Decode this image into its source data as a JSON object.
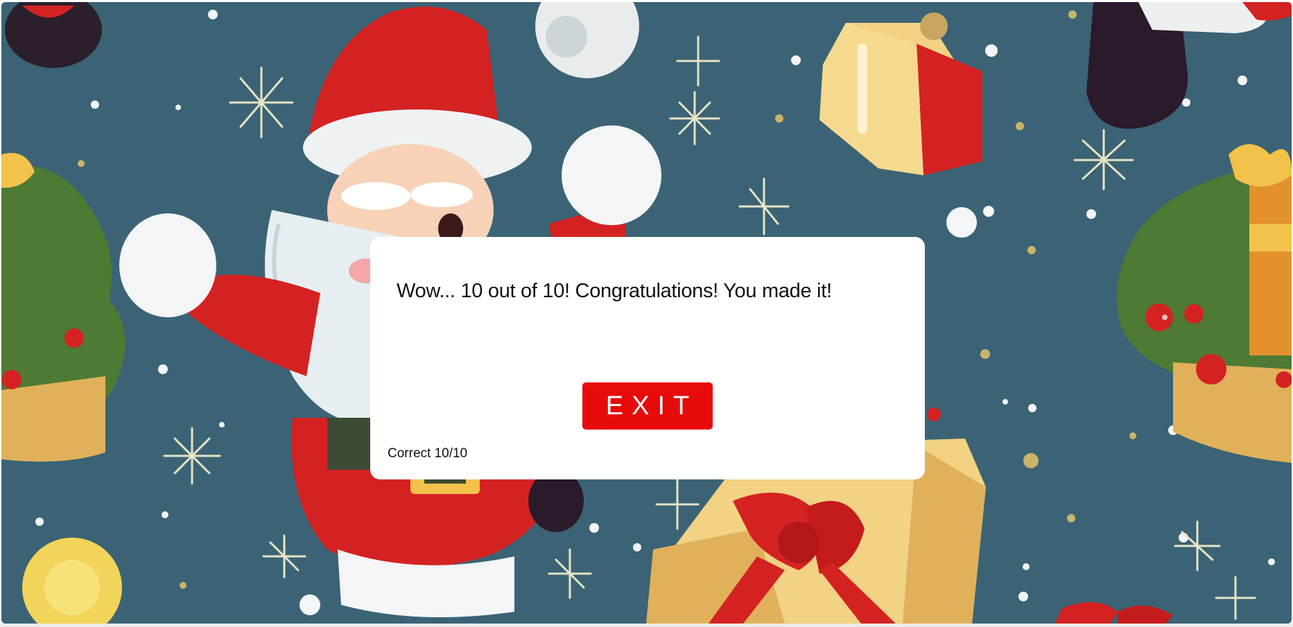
{
  "game": {
    "result_message": "Wow... 10 out of 10! Congratulations! You made it!",
    "exit_label": "EXIT",
    "score_text": "Correct 10/10",
    "score_correct": 10,
    "score_total": 10
  },
  "background": {
    "scene": "christmas-santa-gifts-pattern",
    "colors": {
      "sky": "#3b6375",
      "santa_red": "#d42222",
      "fur_white": "#f3f5f6",
      "gift_gold": "#f0c86a",
      "tree_green": "#4f7a34"
    }
  },
  "colors": {
    "modal_bg": "#ffffff",
    "button_bg": "#e80b0b",
    "button_text": "#ffffff",
    "text": "#111111"
  }
}
